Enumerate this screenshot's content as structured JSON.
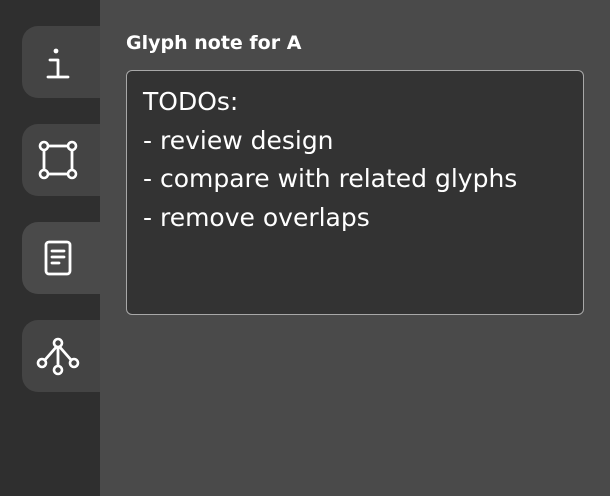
{
  "sidebar": {
    "tabs": [
      {
        "name": "info",
        "icon": "info-icon",
        "active": false
      },
      {
        "name": "selection",
        "icon": "bounding-box-icon",
        "active": false
      },
      {
        "name": "note",
        "icon": "note-icon",
        "active": true
      },
      {
        "name": "related",
        "icon": "tree-graph-icon",
        "active": false
      }
    ]
  },
  "panel": {
    "title": "Glyph note for A",
    "note": "TODOs:\n- review design\n- compare with related glyphs\n- remove overlaps"
  },
  "colors": {
    "sidebar_bg": "#2f2f2f",
    "panel_bg": "#4a4a4a",
    "note_bg": "#333333",
    "text": "#ffffff"
  }
}
